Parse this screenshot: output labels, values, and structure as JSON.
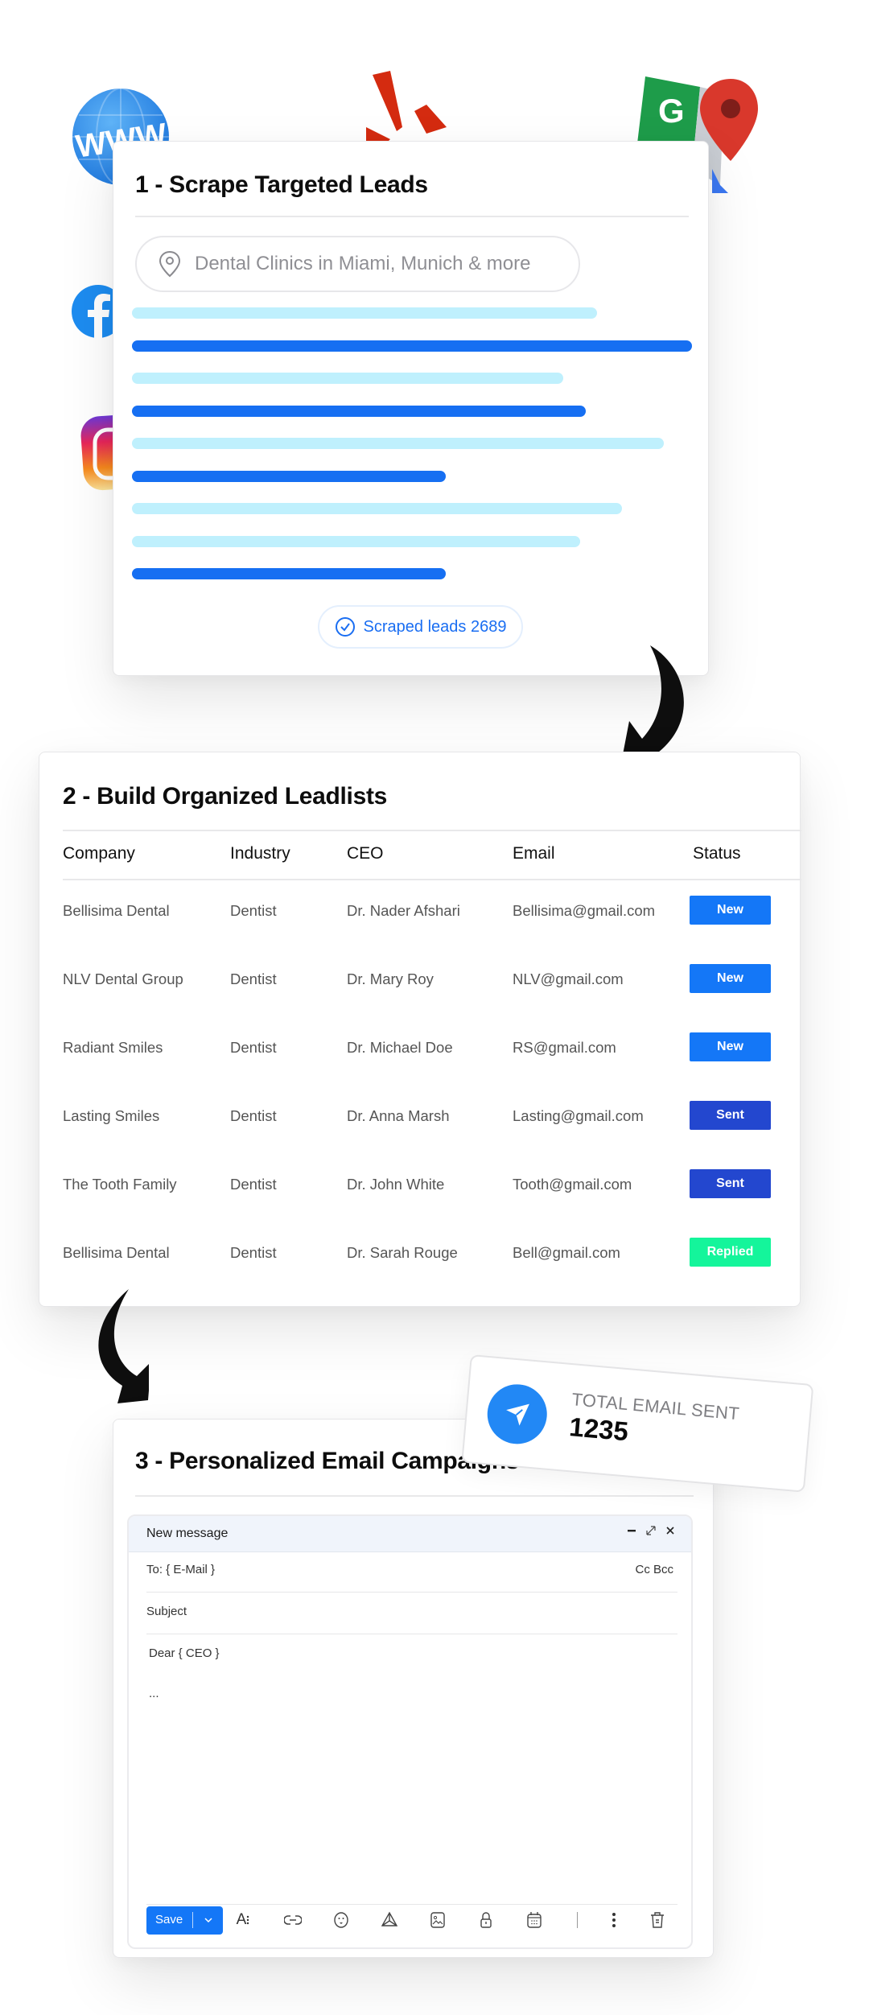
{
  "sources": {
    "icons": [
      "www-globe-icon",
      "yelp-icon",
      "google-maps-icon",
      "facebook-icon",
      "instagram-icon"
    ],
    "www_label": "WWW"
  },
  "step1": {
    "title": "1 - Scrape Targeted Leads",
    "search_placeholder": "Dental Clinics in Miami, Munich & more",
    "result_lines": [
      {
        "tone": "light",
        "fill": 0.83
      },
      {
        "tone": "dark",
        "fill": 1.0
      },
      {
        "tone": "light",
        "fill": 0.77
      },
      {
        "tone": "dark",
        "fill": 0.81
      },
      {
        "tone": "light",
        "fill": 0.95
      },
      {
        "tone": "dark",
        "fill": 0.56
      },
      {
        "tone": "light",
        "fill": 0.875
      },
      {
        "tone": "light",
        "fill": 0.8
      },
      {
        "tone": "dark",
        "fill": 0.56
      }
    ],
    "scraped_label": "Scraped leads 2689"
  },
  "step2": {
    "title": "2 - Build Organized Leadlists",
    "columns": [
      "Company",
      "Industry",
      "CEO",
      "Email",
      "Status"
    ],
    "rows": [
      {
        "company": "Bellisima Dental",
        "industry": "Dentist",
        "ceo": "Dr. Nader Afshari",
        "email": "Bellisima@gmail.com",
        "status": "New"
      },
      {
        "company": "NLV Dental Group",
        "industry": "Dentist",
        "ceo": "Dr. Mary Roy",
        "email": "NLV@gmail.com",
        "status": "New"
      },
      {
        "company": "Radiant Smiles",
        "industry": "Dentist",
        "ceo": "Dr. Michael Doe",
        "email": "RS@gmail.com",
        "status": "New"
      },
      {
        "company": "Lasting Smiles",
        "industry": "Dentist",
        "ceo": "Dr. Anna Marsh",
        "email": "Lasting@gmail.com",
        "status": "Sent"
      },
      {
        "company": "The Tooth Family",
        "industry": "Dentist",
        "ceo": "Dr. John White",
        "email": "Tooth@gmail.com",
        "status": "Sent"
      },
      {
        "company": "Bellisima Dental",
        "industry": "Dentist",
        "ceo": "Dr. Sarah Rouge",
        "email": "Bell@gmail.com",
        "status": "Replied"
      }
    ],
    "status_colors": {
      "New": "#1477f7",
      "Sent": "#2347cf",
      "Replied": "#14f59b"
    }
  },
  "stat": {
    "label": "TOTAL EMAIL SENT",
    "value": "1235"
  },
  "step3": {
    "title": "3 - Personalized Email Campaigns",
    "compose": {
      "header": "New message",
      "to": "To: { E-Mail }",
      "cc_bcc": "Cc Bcc",
      "subject": "Subject",
      "body_greeting": "Dear { CEO }",
      "body_ellipsis": "...",
      "save_label": "Save",
      "format_label": "A"
    }
  },
  "colors": {
    "accent_blue": "#166ff2",
    "light_blue": "#bff0fd"
  }
}
